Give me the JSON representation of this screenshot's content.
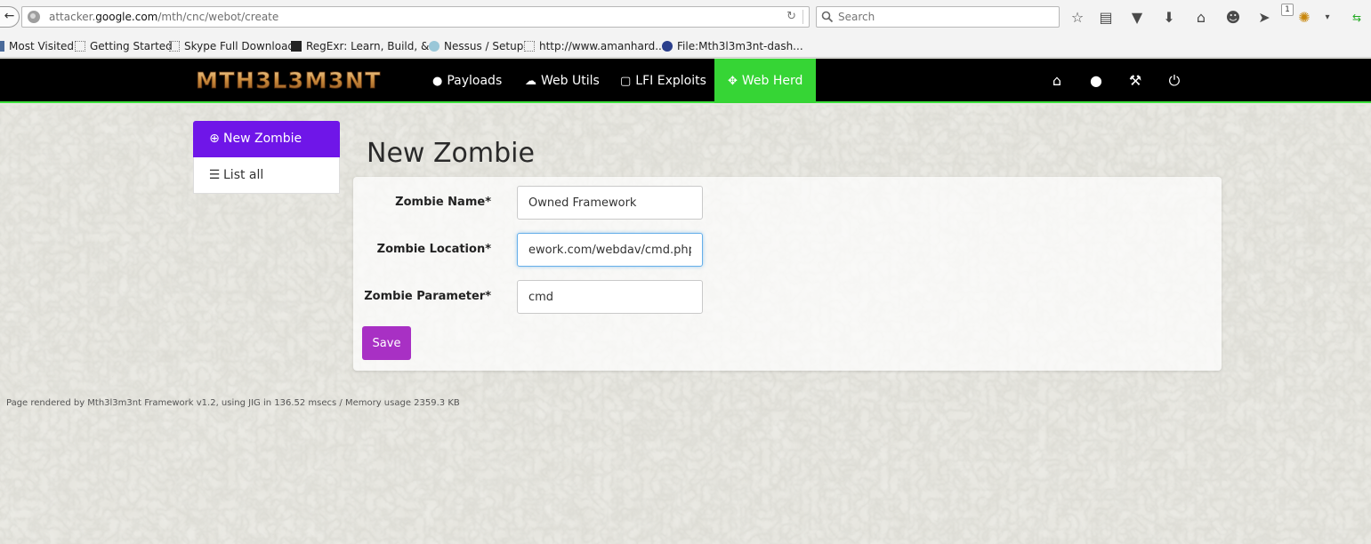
{
  "browser": {
    "url_prefix": "attacker.",
    "url_host": "google.com",
    "url_path": "/mth/cnc/webot/create",
    "search_placeholder": "Search",
    "notification_count": "1",
    "bookmarks": [
      {
        "label": "Most Visited"
      },
      {
        "label": "Getting Started"
      },
      {
        "label": "Skype Full Download"
      },
      {
        "label": "RegExr: Learn, Build, &..."
      },
      {
        "label": "Nessus / Setup"
      },
      {
        "label": "http://www.amanhard..."
      },
      {
        "label": "File:Mth3l3m3nt-dash..."
      }
    ]
  },
  "navbar": {
    "brand": "MTH3L3M3NT",
    "items": [
      {
        "label": "Payloads",
        "icon": "drop-icon"
      },
      {
        "label": "Web Utils",
        "icon": "cloud-icon"
      },
      {
        "label": "LFI Exploits",
        "icon": "file-icon"
      },
      {
        "label": "Web Herd",
        "icon": "crosshair-icon",
        "active": true
      }
    ],
    "right_icons": [
      "home-icon",
      "user-icon",
      "wrench-icon",
      "power-icon"
    ],
    "active_color": "#36d535"
  },
  "sidebar": {
    "items": [
      {
        "label": "New Zombie",
        "icon": "plus-circle-icon",
        "active": true
      },
      {
        "label": "List all",
        "icon": "list-icon"
      }
    ],
    "active_color": "#6f16e8"
  },
  "main": {
    "title": "New Zombie",
    "fields": [
      {
        "label": "Zombie Name*",
        "value": "Owned Framework"
      },
      {
        "label": "Zombie Location*",
        "value": "ework.com/webdav/cmd.php"
      },
      {
        "label": "Zombie Parameter*",
        "value": "cmd"
      }
    ],
    "save_label": "Save",
    "save_color": "#a830c4"
  },
  "footer": {
    "text": "Page rendered by Mth3l3m3nt Framework v1.2, using JIG in 136.52 msecs / Memory usage 2359.3 KB"
  }
}
